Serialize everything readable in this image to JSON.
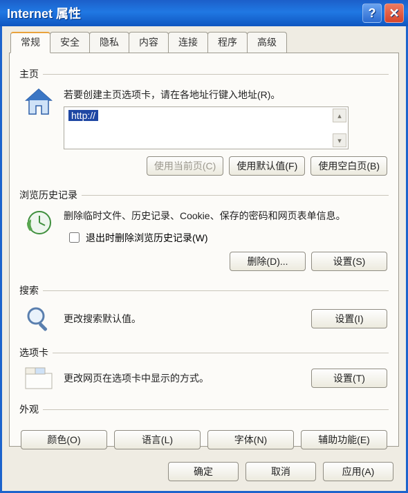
{
  "title": "Internet 属性",
  "tabs": [
    "常规",
    "安全",
    "隐私",
    "内容",
    "连接",
    "程序",
    "高级"
  ],
  "active_tab": 0,
  "home": {
    "legend": "主页",
    "desc": "若要创建主页选项卡，请在各地址行键入地址(R)。",
    "url_text": "http://",
    "btn_current": "使用当前页(C)",
    "btn_default": "使用默认值(F)",
    "btn_blank": "使用空白页(B)"
  },
  "history": {
    "legend": "浏览历史记录",
    "desc": "删除临时文件、历史记录、Cookie、保存的密码和网页表单信息。",
    "checkbox_label": "退出时删除浏览历史记录(W)",
    "btn_delete": "删除(D)...",
    "btn_settings": "设置(S)"
  },
  "search": {
    "legend": "搜索",
    "desc": "更改搜索默认值。",
    "btn_settings": "设置(I)"
  },
  "tabs_section": {
    "legend": "选项卡",
    "desc": "更改网页在选项卡中显示的方式。",
    "btn_settings": "设置(T)"
  },
  "appearance": {
    "legend": "外观",
    "btn_colors": "颜色(O)",
    "btn_lang": "语言(L)",
    "btn_fonts": "字体(N)",
    "btn_access": "辅助功能(E)"
  },
  "dialog": {
    "ok": "确定",
    "cancel": "取消",
    "apply": "应用(A)"
  }
}
